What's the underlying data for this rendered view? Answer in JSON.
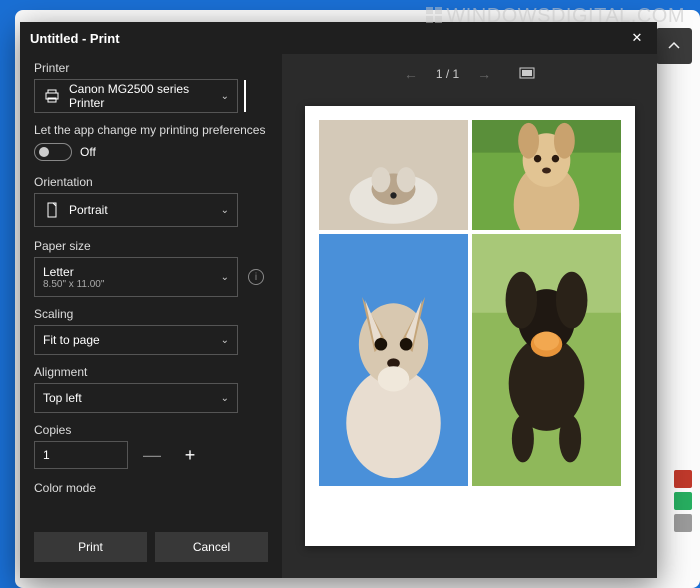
{
  "watermark": "WINDOWSDIGITAL.COM",
  "dialog": {
    "title": "Untitled - Print",
    "close_label": "✕"
  },
  "printer": {
    "label": "Printer",
    "selected": "Canon MG2500 series Printer"
  },
  "pref": {
    "text": "Let the app change my printing preferences",
    "toggle_state": "Off"
  },
  "orientation": {
    "label": "Orientation",
    "value": "Portrait"
  },
  "paper_size": {
    "label": "Paper size",
    "value": "Letter",
    "sub": "8.50\" x 11.00\""
  },
  "scaling": {
    "label": "Scaling",
    "value": "Fit to page"
  },
  "alignment": {
    "label": "Alignment",
    "value": "Top left"
  },
  "copies": {
    "label": "Copies",
    "value": "1"
  },
  "color_mode": {
    "label": "Color mode"
  },
  "actions": {
    "print": "Print",
    "cancel": "Cancel"
  },
  "preview": {
    "page_indicator": "1 / 1"
  },
  "background_colors": [
    "#c0392b",
    "#27ae60",
    "#9b9b9b"
  ]
}
